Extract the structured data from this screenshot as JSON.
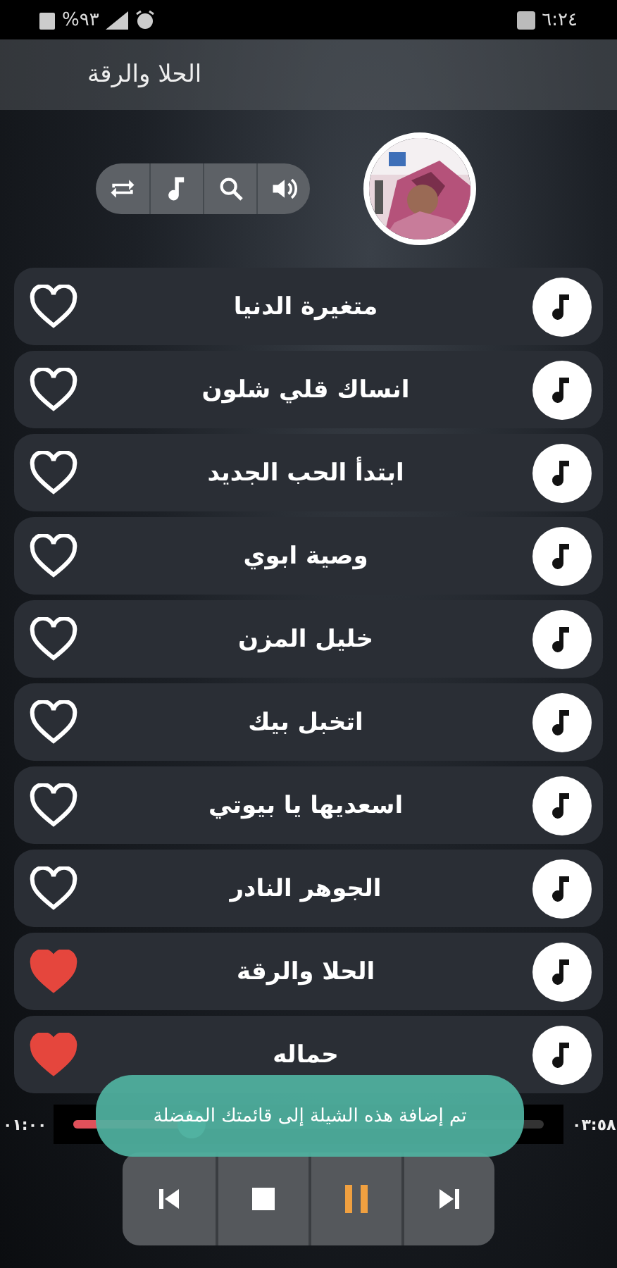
{
  "status_bar": {
    "battery": "%٩٣",
    "time": "٦:٢٤"
  },
  "title_bar": {
    "title": "الحلا والرقة"
  },
  "songs": [
    {
      "title": "متغيرة الدنيا",
      "favorite": false
    },
    {
      "title": "انساك قلي شلون",
      "favorite": false
    },
    {
      "title": "ابتدأ الحب الجديد",
      "favorite": false
    },
    {
      "title": "وصية ابوي",
      "favorite": false
    },
    {
      "title": "خليل المزن",
      "favorite": false
    },
    {
      "title": "اتخبل بيك",
      "favorite": false
    },
    {
      "title": "اسعديها يا بيوتي",
      "favorite": false
    },
    {
      "title": "الجوهر النادر",
      "favorite": false
    },
    {
      "title": "الحلا والرقة",
      "favorite": true
    },
    {
      "title": "حماله",
      "favorite": true
    }
  ],
  "player": {
    "elapsed": "٠١:٠٠",
    "duration": "٠٣:٥٨",
    "level": 0.25
  },
  "toast": {
    "message": "تم إضافة هذه الشيلة إلى قائمتك المفضلة"
  }
}
